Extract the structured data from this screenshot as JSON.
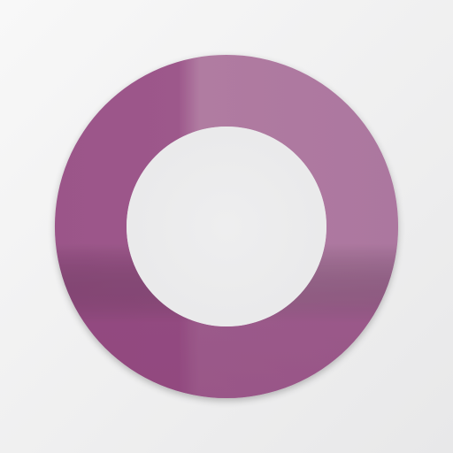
{
  "icon": {
    "shape": "ring",
    "colors": {
      "background_light": "#f8f8f8",
      "background_dark": "#e9e9ea",
      "ring_base": "#9b5589",
      "ring_highlight": "#b07ba1",
      "inner_fill": "#ededee"
    }
  }
}
